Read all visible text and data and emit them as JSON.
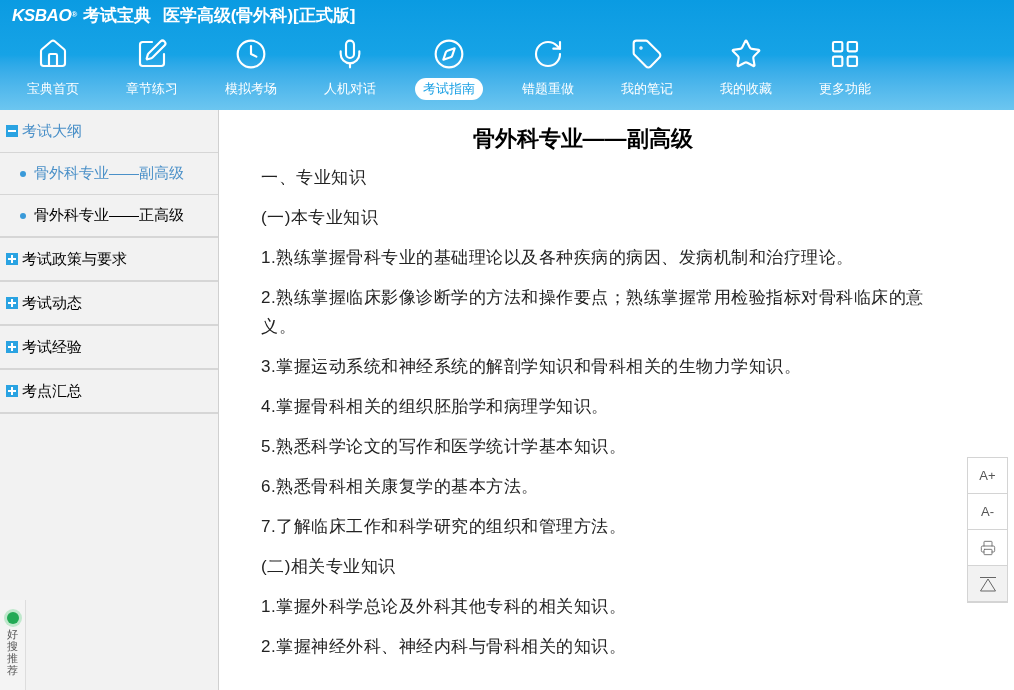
{
  "app": {
    "brand": "KSBAO",
    "mark": "®",
    "brand_name": "考试宝典",
    "title": "医学高级(骨外科)[正式版]"
  },
  "nav": [
    {
      "kind": "home",
      "label": "宝典首页",
      "selected": false
    },
    {
      "kind": "edit",
      "label": "章节练习",
      "selected": false
    },
    {
      "kind": "clock",
      "label": "模拟考场",
      "selected": false
    },
    {
      "kind": "mic",
      "label": "人机对话",
      "selected": false
    },
    {
      "kind": "compass",
      "label": "考试指南",
      "selected": true
    },
    {
      "kind": "redo",
      "label": "错题重做",
      "selected": false
    },
    {
      "kind": "tag",
      "label": "我的笔记",
      "selected": false
    },
    {
      "kind": "star",
      "label": "我的收藏",
      "selected": false
    },
    {
      "kind": "grid",
      "label": "更多功能",
      "selected": false
    }
  ],
  "sidebar": [
    {
      "label": "考试大纲",
      "expanded": true,
      "children": [
        {
          "label": "骨外科专业——副高级",
          "selected": true
        },
        {
          "label": "骨外科专业——正高级",
          "selected": false
        }
      ]
    },
    {
      "label": "考试政策与要求",
      "expanded": false
    },
    {
      "label": "考试动态",
      "expanded": false
    },
    {
      "label": "考试经验",
      "expanded": false
    },
    {
      "label": "考点汇总",
      "expanded": false
    }
  ],
  "content": {
    "title": "骨外科专业——副高级",
    "paragraphs": [
      "一、专业知识",
      "(一)本专业知识",
      "1.熟练掌握骨科专业的基础理论以及各种疾病的病因、发病机制和治疗理论。",
      "2.熟练掌握临床影像诊断学的方法和操作要点；熟练掌握常用检验指标对骨科临床的意义。",
      "3.掌握运动系统和神经系统的解剖学知识和骨科相关的生物力学知识。",
      "4.掌握骨科相关的组织胚胎学和病理学知识。",
      "5.熟悉科学论文的写作和医学统计学基本知识。",
      "6.熟悉骨科相关康复学的基本方法。",
      "7.了解临床工作和科学研究的组织和管理方法。",
      "(二)相关专业知识",
      "1.掌握外科学总论及外科其他专科的相关知识。",
      "2.掌握神经外科、神经内科与骨科相关的知识。"
    ]
  },
  "tools": [
    {
      "kind": "text",
      "label": "A+"
    },
    {
      "kind": "text",
      "label": "A-"
    },
    {
      "kind": "print"
    },
    {
      "kind": "top"
    }
  ],
  "widget": {
    "label": "好搜推荐"
  }
}
